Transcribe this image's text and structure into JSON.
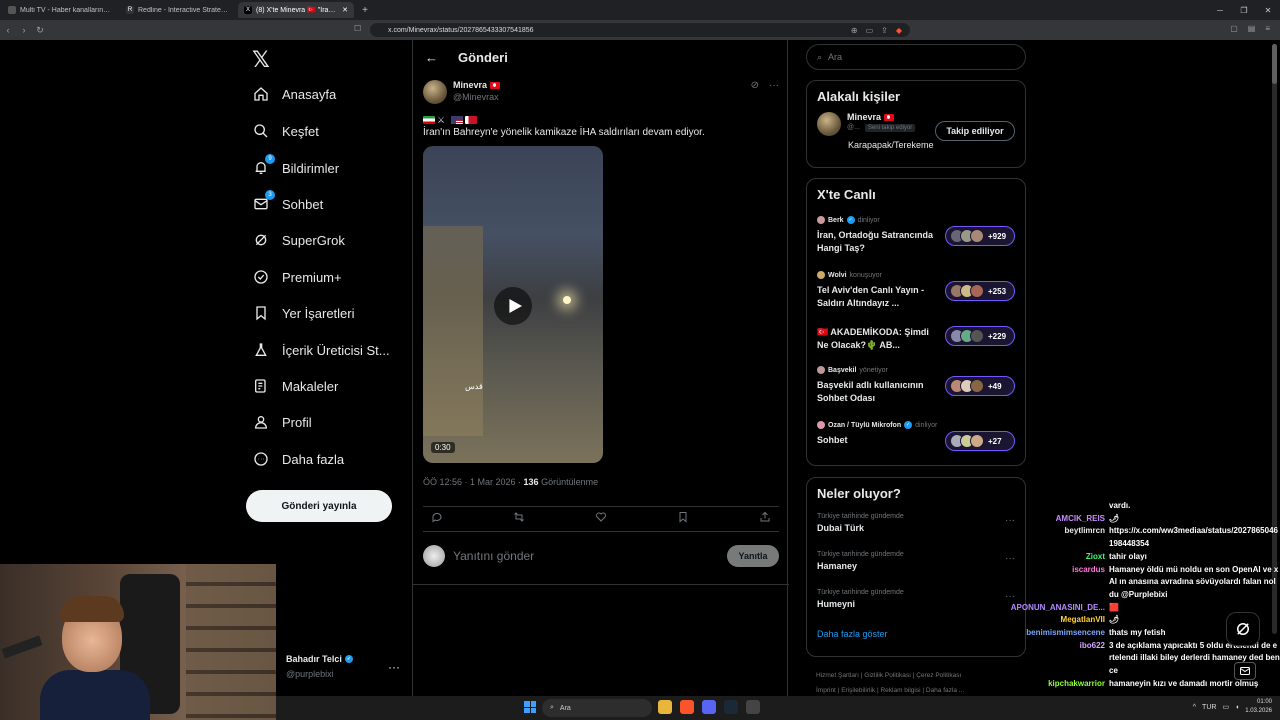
{
  "browser": {
    "tabs": [
      {
        "title": "Multi TV - Haber kanallarını aynı anda",
        "active": false
      },
      {
        "title": "Redline - Interactive Strategic Map",
        "active": false
      },
      {
        "title": "(8) X'te Minevra 🇹🇷 \"İran'ın Bahreyn'e yönelik",
        "active": true
      }
    ],
    "url": "x.com/Minevrax/status/2027865433307541856"
  },
  "sidebar": {
    "items": [
      {
        "label": "Anasayfa",
        "icon": "home-icon"
      },
      {
        "label": "Keşfet",
        "icon": "search-icon"
      },
      {
        "label": "Bildirimler",
        "icon": "bell-icon",
        "badge": "9"
      },
      {
        "label": "Sohbet",
        "icon": "mail-icon",
        "badge": "3"
      },
      {
        "label": "SuperGrok",
        "icon": "grok-icon"
      },
      {
        "label": "Premium+",
        "icon": "verified-icon"
      },
      {
        "label": "Yer İşaretleri",
        "icon": "bookmark-icon"
      },
      {
        "label": "İçerik Üreticisi St...",
        "icon": "flask-icon"
      },
      {
        "label": "Makaleler",
        "icon": "article-icon"
      },
      {
        "label": "Profil",
        "icon": "person-icon"
      },
      {
        "label": "Daha fazla",
        "icon": "more-circle-icon"
      }
    ],
    "post_button": "Gönderi yayınla",
    "account": {
      "name": "Bahadır Telci",
      "handle": "@purplebixi"
    }
  },
  "main": {
    "title": "Gönderi",
    "tweet": {
      "author_name": "Minevra",
      "author_handle": "@Minevrax",
      "text": "İran'ın Bahreyn'e yönelik kamikaze İHA saldırıları devam ediyor.",
      "video_duration": "0:30",
      "video_watermark": "قدس",
      "time": "ÖÖ 12:56 · 1 Mar 2026 · ",
      "views_count": "136",
      "views_label": " Görüntülenme"
    },
    "reply_placeholder": "Yanıtını gönder",
    "reply_button": "Yanıtla"
  },
  "right": {
    "search_placeholder": "Ara",
    "related": {
      "title": "Alakalı kişiler",
      "name": "Minevra",
      "handle": "@...",
      "follows_you": "Seni takip ediyor",
      "follow_button": "Takip ediliyor",
      "bio": "Karapapak/Terekeme"
    },
    "live": {
      "title": "X'te Canlı",
      "spaces": [
        {
          "host": "Berk",
          "role": "dinliyor",
          "title": "İran, Ortadoğu Satrancında Hangi Taş?",
          "count": "+929"
        },
        {
          "host": "Wolvi",
          "role": "konuşuyor",
          "title": "Tel Aviv'den Canlı Yayın - Saldırı Altındayız ...",
          "count": "+253"
        },
        {
          "host": "",
          "role": "",
          "title": "🇹🇷 AKADEMİKODA: Şimdi Ne Olacak?🌵 AB...",
          "count": "+229"
        },
        {
          "host": "Başvekil",
          "role": "yönetiyor",
          "title": "Başvekil adlı kullanıcının Sohbet Odası",
          "count": "+49"
        },
        {
          "host": "Ozan / Tüylü Mikrofon",
          "role": "dinliyor",
          "title": "Sohbet",
          "count": "+27"
        }
      ]
    },
    "trends": {
      "title": "Neler oluyor?",
      "items": [
        {
          "context": "Türkiye tarihinde gündemde",
          "name": "Dubai Türk"
        },
        {
          "context": "Türkiye tarihinde gündemde",
          "name": "Hamaney"
        },
        {
          "context": "Türkiye tarihinde gündemde",
          "name": "Humeyni"
        }
      ],
      "show_more": "Daha fazla göster"
    },
    "footer": [
      "Hizmet Şartları",
      "Gizlilik Politikası",
      "Çerez Politikası",
      "İmprint",
      "Erişilebilirlik",
      "Reklam bilgisi",
      "Daha fazla ..."
    ]
  },
  "chat": [
    {
      "user": "",
      "color": "#ffffff",
      "msg": "vardı."
    },
    {
      "user": "AMCIK_REIS",
      "color": "#c98bff",
      "msg": "🌶"
    },
    {
      "user": "beytlimrcn",
      "color": "#ffffff",
      "msg": "https://x.com/ww3mediaa/status/2027865046198448354"
    },
    {
      "user": "Zioxt",
      "color": "#3cff6b",
      "msg": "tahir olayı"
    },
    {
      "user": "iscardus",
      "color": "#ff7ad9",
      "msg": "Hamaney öldü mü noldu en son OpenAI ve xAI ın anasına avradına sövüyolardı falan noldu @Purplebixi"
    },
    {
      "user": "APONUN_ANASINI_DE...",
      "color": "#b58bff",
      "msg": "🟥"
    },
    {
      "user": "MegatlanVII",
      "color": "#ffd23c",
      "msg": "🌶"
    },
    {
      "user": "benimismimsencene",
      "color": "#7aa8ff",
      "msg": "thats my fetish"
    },
    {
      "user": "ibo622",
      "color": "#d6a6ff",
      "msg": "3 de açıklama yapıcaktı 5 oldu ertelendi de ertelendi illaki biley derlerdi hamaney ded bence"
    },
    {
      "user": "kipchakwarrior",
      "color": "#8bff3c",
      "msg": "hamaneyin kızı ve damadı mortir olmuş"
    }
  ],
  "taskbar": {
    "search": "Ara",
    "lang": "TUR",
    "time": "01:00",
    "date": "1.03.2026"
  }
}
